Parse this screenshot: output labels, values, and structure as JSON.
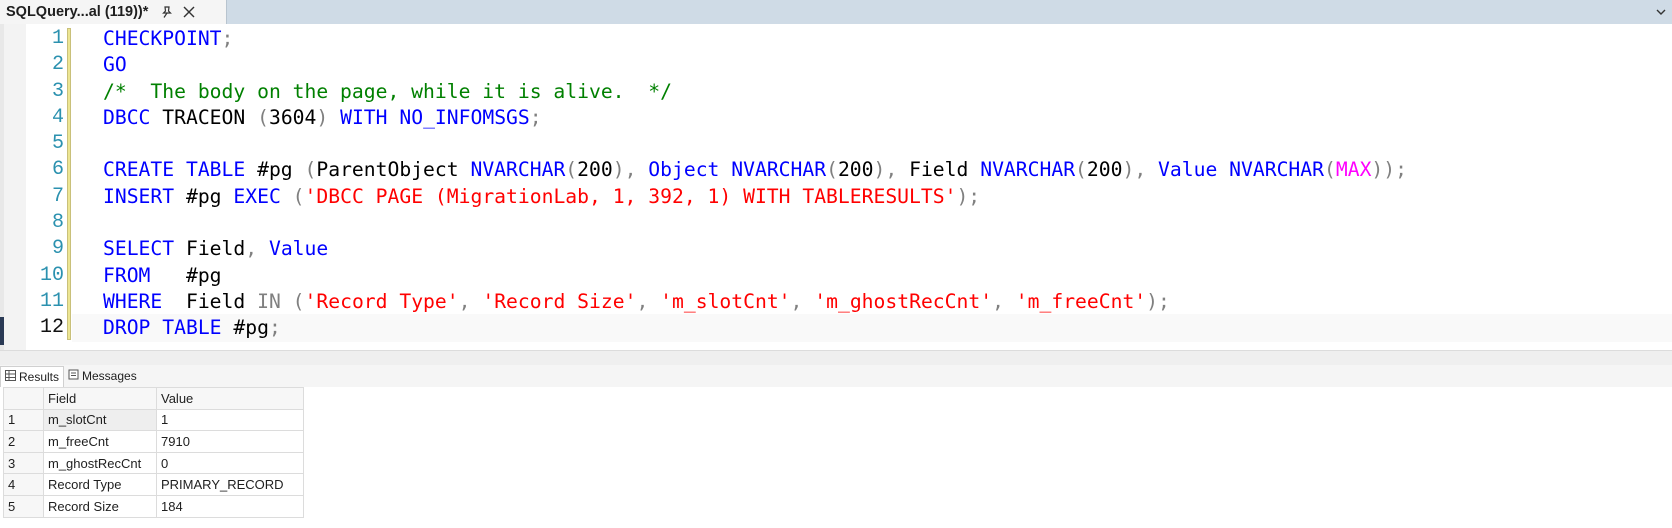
{
  "tab": {
    "title": "SQLQuery...al (119))*"
  },
  "editor": {
    "line_numbers": [
      "1",
      "2",
      "3",
      "4",
      "5",
      "6",
      "7",
      "8",
      "9",
      "10",
      "11",
      "12"
    ],
    "lines": {
      "l1": {
        "a": "CHECKPOINT",
        "b": ";"
      },
      "l2": {
        "a": "GO"
      },
      "l3": {
        "a": "/*  The body on the page, while it is alive.  */"
      },
      "l4": {
        "a": "DBCC",
        "b": " TRACEON ",
        "c": "(",
        "d": "3604",
        "e": ")",
        "f": " WITH NO_INFOMSGS",
        "g": ";"
      },
      "l6": {
        "a": "CREATE TABLE",
        "b": " #pg ",
        "c": "(",
        "d": "ParentObject ",
        "e": "NVARCHAR",
        "f": "(",
        "g": "200",
        "h": "),",
        "i": " Object ",
        "j": "NVARCHAR",
        "k": "(",
        "l": "200",
        "m": "),",
        "n": " Field ",
        "o": "NVARCHAR",
        "p": "(",
        "q": "200",
        "r": "),",
        "s": " Value ",
        "t": "NVARCHAR",
        "u": "(",
        "v": "MAX",
        "w": "));"
      },
      "l7": {
        "a": "INSERT",
        "b": " #pg ",
        "c": "EXEC",
        "d": " (",
        "e": "'DBCC PAGE (MigrationLab, 1, 392, 1) WITH TABLERESULTS'",
        "f": ");"
      },
      "l9": {
        "a": "SELECT",
        "b": " Field",
        "c": ",",
        "d": " Value"
      },
      "l10": {
        "a": "FROM",
        "b": "   #pg"
      },
      "l11": {
        "a": "WHERE",
        "b": "  Field ",
        "c": "IN",
        "d": " (",
        "e": "'Record Type'",
        "f": ", ",
        "g": "'Record Size'",
        "h": ", ",
        "i": "'m_slotCnt'",
        "j": ", ",
        "k": "'m_ghostRecCnt'",
        "l": ", ",
        "m": "'m_freeCnt'",
        "n": ");"
      },
      "l12": {
        "a": "DROP TABLE",
        "b": " #pg",
        "c": ";"
      }
    }
  },
  "results": {
    "tabs": {
      "results": "Results",
      "messages": "Messages"
    },
    "columns": {
      "field": "Field",
      "value": "Value"
    },
    "rows": [
      {
        "n": "1",
        "field": "m_slotCnt",
        "value": "1"
      },
      {
        "n": "2",
        "field": "m_freeCnt",
        "value": "7910"
      },
      {
        "n": "3",
        "field": "m_ghostRecCnt",
        "value": "0"
      },
      {
        "n": "4",
        "field": "Record Type",
        "value": "PRIMARY_RECORD"
      },
      {
        "n": "5",
        "field": "Record Size",
        "value": "184"
      }
    ]
  },
  "icons": {
    "pin": "pin-icon",
    "close": "close-icon",
    "results": "grid-icon",
    "messages": "messages-icon",
    "overflow": "chevron-down-icon"
  },
  "colors": {
    "keyword": "#0000ff",
    "comment": "#008000",
    "string": "#ff0000",
    "function": "#ff00ff",
    "operator": "#808080",
    "line_number": "#2b91af"
  }
}
